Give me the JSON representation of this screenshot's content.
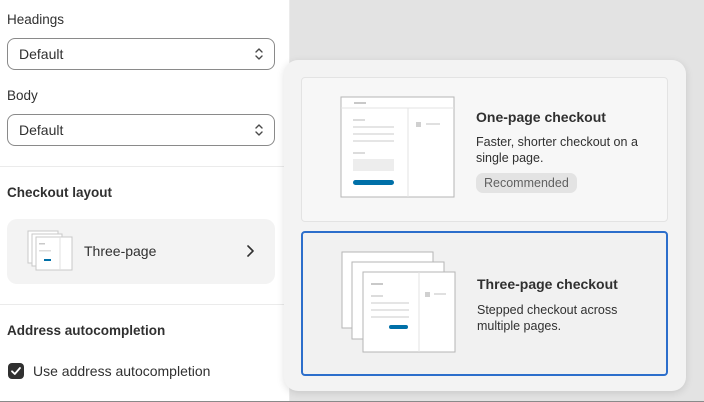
{
  "settings": {
    "headings_label": "Headings",
    "headings_value": "Default",
    "body_label": "Body",
    "body_value": "Default",
    "checkout_layout_title": "Checkout layout",
    "checkout_layout_value": "Three-page",
    "address_title": "Address autocompletion",
    "address_checkbox_label": "Use address autocompletion",
    "address_checkbox_checked": true
  },
  "popover": {
    "options": [
      {
        "title": "One-page checkout",
        "description": "Faster, shorter checkout on a single page.",
        "badge": "Recommended",
        "selected": false
      },
      {
        "title": "Three-page checkout",
        "description": "Stepped checkout across multiple pages.",
        "selected": true
      }
    ]
  },
  "colors": {
    "accent": "#2c6ecb",
    "illustration_button": "#0070a8"
  }
}
